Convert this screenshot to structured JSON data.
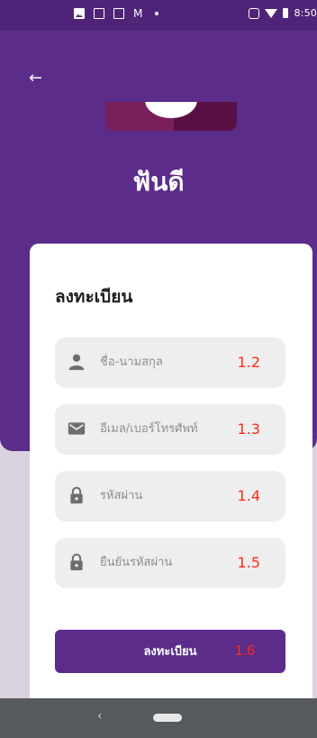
{
  "status_bar": {
    "time": "8:50",
    "icons": [
      "image-icon",
      "document-icon",
      "mail-out-icon",
      "gmail-icon",
      "dot-icon",
      "vibrate-icon",
      "wifi-icon",
      "battery-icon"
    ]
  },
  "header": {
    "back_icon": "←",
    "app_title": "ฟันดี"
  },
  "form": {
    "title": "ลงทะเบียน",
    "fields": [
      {
        "placeholder": "ชื่อ-นามสกุล",
        "tag": "1.2",
        "icon": "person-icon"
      },
      {
        "placeholder": "อีเมล/เบอร์โทรศัพท์",
        "tag": "1.3",
        "icon": "mail-icon"
      },
      {
        "placeholder": "รหัสผ่าน",
        "tag": "1.4",
        "icon": "lock-icon"
      },
      {
        "placeholder": "ยืนยันรหัสผ่าน",
        "tag": "1.5",
        "icon": "lock-icon"
      }
    ],
    "submit": {
      "label": "ลงทะเบียน",
      "tag": "1.6"
    }
  },
  "nav_bar": {
    "back_glyph": "‹"
  },
  "colors": {
    "primary": "#5b2c8a",
    "status_bar": "#4f2478",
    "tag": "#ff2a1a",
    "field_bg": "#eeeeee",
    "placeholder": "#8d8d8d"
  }
}
